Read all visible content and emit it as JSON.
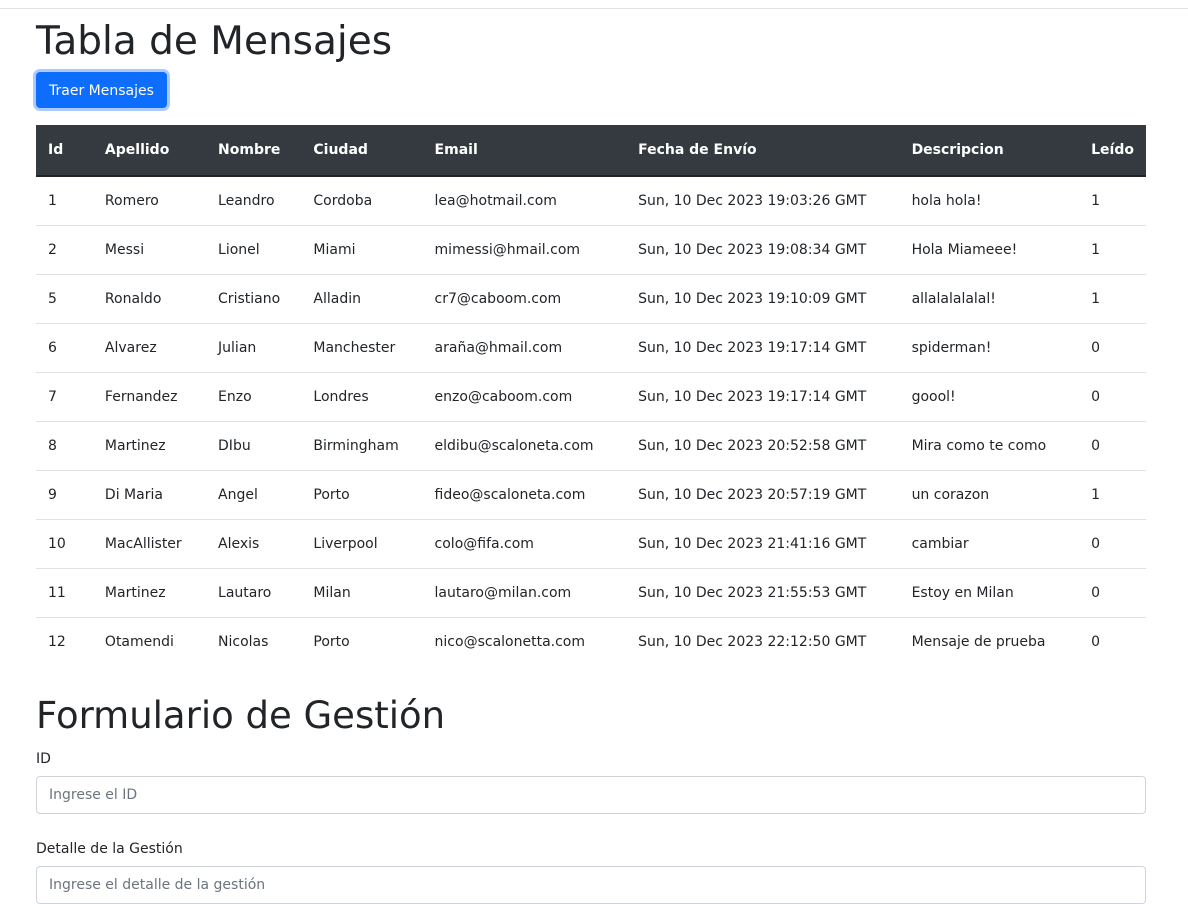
{
  "page": {
    "title": "Tabla de Mensajes",
    "fetch_button_label": "Traer Mensajes"
  },
  "table": {
    "headers": [
      "Id",
      "Apellido",
      "Nombre",
      "Ciudad",
      "Email",
      "Fecha de Envío",
      "Descripcion",
      "Leído"
    ],
    "rows": [
      [
        "1",
        "Romero",
        "Leandro",
        "Cordoba",
        "lea@hotmail.com",
        "Sun, 10 Dec 2023 19:03:26 GMT",
        "hola hola!",
        "1"
      ],
      [
        "2",
        "Messi",
        "Lionel",
        "Miami",
        "mimessi@hmail.com",
        "Sun, 10 Dec 2023 19:08:34 GMT",
        "Hola Miameee!",
        "1"
      ],
      [
        "5",
        "Ronaldo",
        "Cristiano",
        "Alladin",
        "cr7@caboom.com",
        "Sun, 10 Dec 2023 19:10:09 GMT",
        "allalalalalal!",
        "1"
      ],
      [
        "6",
        "Alvarez",
        "Julian",
        "Manchester",
        "araña@hmail.com",
        "Sun, 10 Dec 2023 19:17:14 GMT",
        "spiderman!",
        "0"
      ],
      [
        "7",
        "Fernandez",
        "Enzo",
        "Londres",
        "enzo@caboom.com",
        "Sun, 10 Dec 2023 19:17:14 GMT",
        "goool!",
        "0"
      ],
      [
        "8",
        "Martinez",
        "DIbu",
        "Birmingham",
        "eldibu@scaloneta.com",
        "Sun, 10 Dec 2023 20:52:58 GMT",
        "Mira como te como",
        "0"
      ],
      [
        "9",
        "Di Maria",
        "Angel",
        "Porto",
        "fideo@scaloneta.com",
        "Sun, 10 Dec 2023 20:57:19 GMT",
        "un corazon",
        "1"
      ],
      [
        "10",
        "MacAllister",
        "Alexis",
        "Liverpool",
        "colo@fifa.com",
        "Sun, 10 Dec 2023 21:41:16 GMT",
        "cambiar",
        "0"
      ],
      [
        "11",
        "Martinez",
        "Lautaro",
        "Milan",
        "lautaro@milan.com",
        "Sun, 10 Dec 2023 21:55:53 GMT",
        "Estoy en Milan",
        "0"
      ],
      [
        "12",
        "Otamendi",
        "Nicolas",
        "Porto",
        "nico@scalonetta.com",
        "Sun, 10 Dec 2023 22:12:50 GMT",
        "Mensaje de prueba",
        "0"
      ]
    ]
  },
  "form": {
    "title": "Formulario de Gestión",
    "id_label": "ID",
    "id_placeholder": "Ingrese el ID",
    "id_value": "",
    "detail_label": "Detalle de la Gestión",
    "detail_placeholder": "Ingrese el detalle de la gestión",
    "detail_value": ""
  },
  "colors": {
    "primary": "#0d6efd",
    "table_header_bg": "#343a40",
    "text": "#212529",
    "border": "#dee2e6"
  }
}
